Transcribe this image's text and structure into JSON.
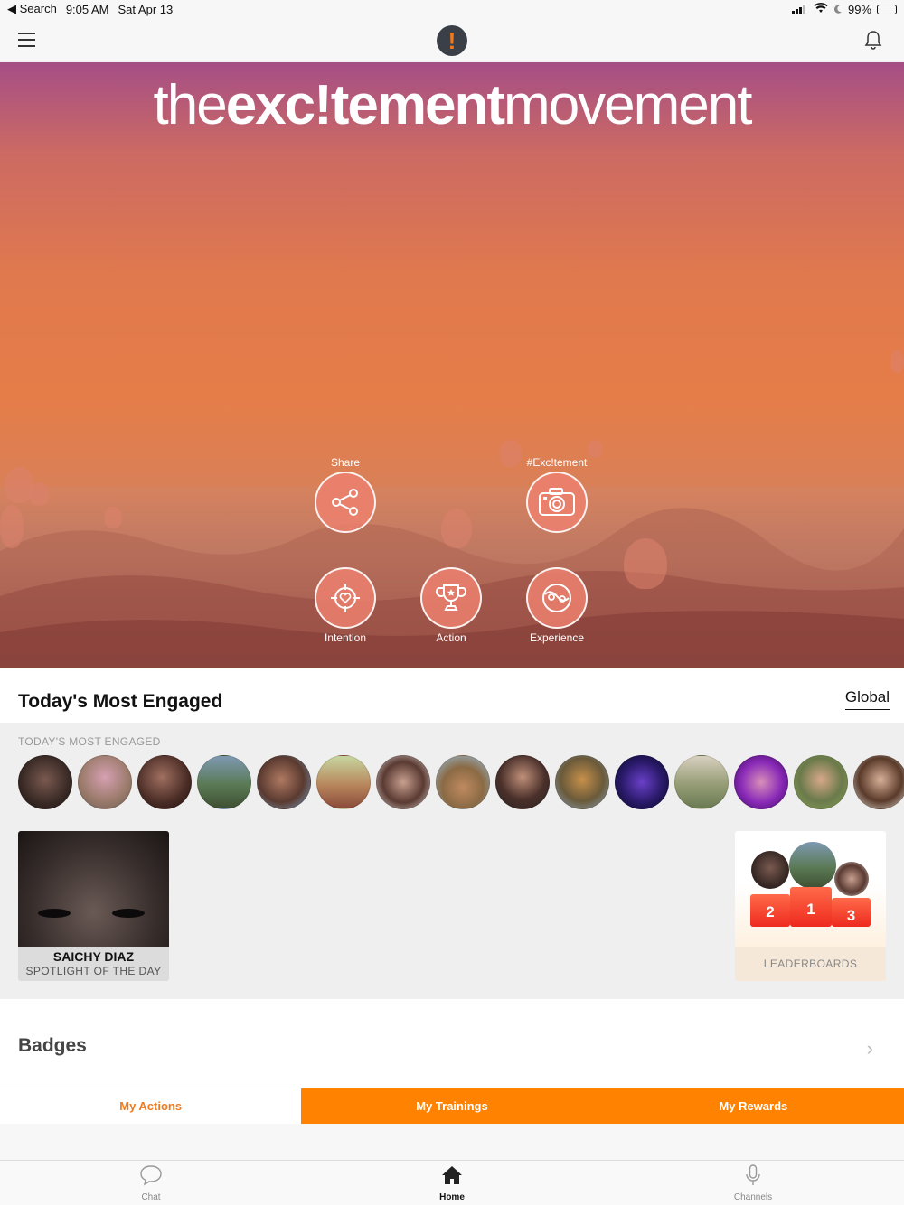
{
  "status_bar": {
    "back_label": "◀ Search",
    "time": "9:05 AM",
    "date": "Sat Apr 13",
    "battery": "99%"
  },
  "hero": {
    "brand_light_1": "the",
    "brand_bold": "exc!tement",
    "brand_light_2": "movement",
    "actions": {
      "share": "Share",
      "excitement": "#Exc!tement",
      "intention": "Intention",
      "action": "Action",
      "experience": "Experience"
    }
  },
  "engaged": {
    "title": "Today's Most Engaged",
    "scope_link": "Global",
    "subtitle": "TODAY'S MOST ENGAGED",
    "spotlight": {
      "name": "SAICHY DIAZ",
      "caption": "SPOTLIGHT OF THE DAY"
    },
    "leaderboard": {
      "label": "LEADERBOARDS",
      "ranks": [
        "2",
        "1",
        "3"
      ]
    }
  },
  "badges": {
    "title": "Badges",
    "tabs": [
      "My Actions",
      "My Trainings",
      "My Rewards"
    ]
  },
  "tabbar": {
    "chat": "Chat",
    "home": "Home",
    "channels": "Channels"
  },
  "colors": {
    "accent": "#ff8200",
    "accent_text": "#f07b1f"
  }
}
